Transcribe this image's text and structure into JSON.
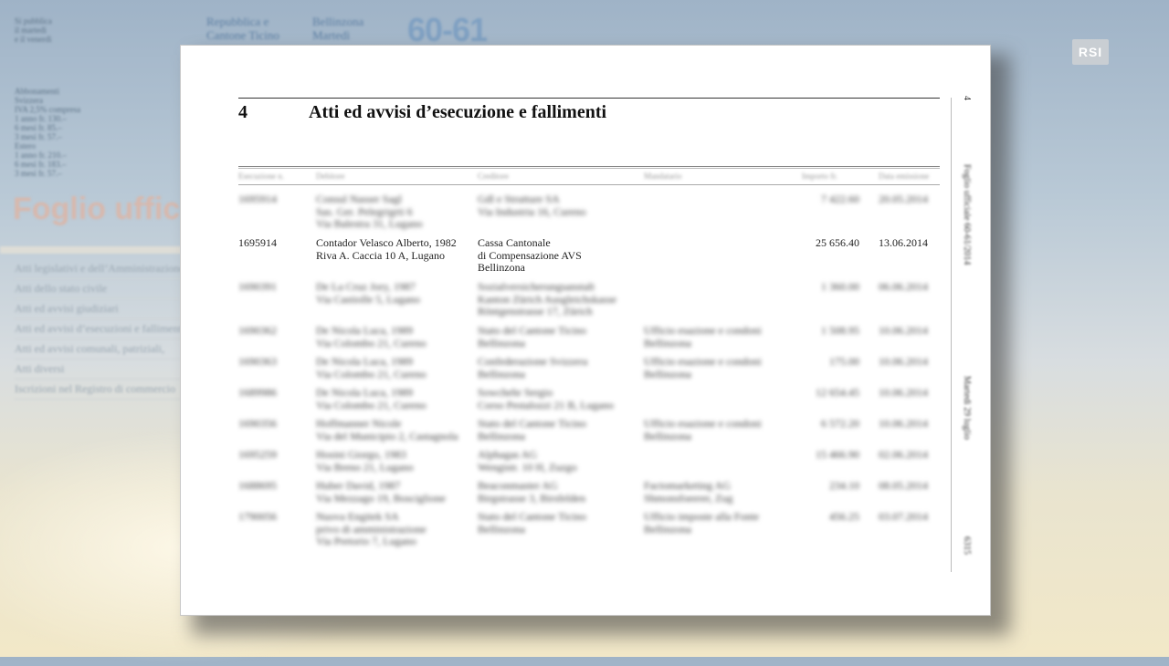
{
  "background": {
    "header_left": [
      "Si pubblica",
      "il martedì",
      "e il venerdì"
    ],
    "subscriptions": [
      "Abbonamenti",
      "Svizzera",
      "IVA 2,5% compresa",
      "1 anno fr. 130.–",
      "6 mesi fr. 85.–",
      "3 mesi fr. 57.–",
      "Estero",
      "1 anno fr. 210.–",
      "6 mesi fr. 183.–",
      "3 mesi fr. 57.–"
    ],
    "header_col1": [
      "Repubblica e",
      "Cantone Ticino"
    ],
    "header_col2": [
      "Bellinzona",
      "Martedì"
    ],
    "issue_number": "60-61",
    "masthead": "Foglio uffic",
    "menu": [
      "Atti legislativi e dell’Amministrazione",
      "Atti dello stato civile",
      "Atti ed avvisi giudiziari",
      "Atti ed avvisi d’esecuzioni e fallimenti",
      "Atti ed avvisi comunali, patriziali,",
      "Atti diversi",
      "Iscrizioni nel Registro di commercio"
    ]
  },
  "broadcaster_logo": "RSI",
  "document": {
    "section_number": "4",
    "section_title": "Atti ed avvisi d’esecuzione e fallimenti",
    "side_page_num": "4",
    "side_pub": "Foglio ufficiale 60-61/2014",
    "side_date": "Martedì 29 luglio",
    "side_page": "6315",
    "columns": [
      "Esecuzione n.",
      "Debitore",
      "Creditore",
      "Mandatario",
      "Importo fr.",
      "Data emissione"
    ],
    "rows": [
      {
        "num": "1695914",
        "debtor": [
          "Contador Velasco Alberto, 1982",
          "Riva A. Caccia 10 A, Lugano"
        ],
        "creditor": [
          "Cassa Cantonale",
          "di Compensazione AVS",
          "Bellinzona"
        ],
        "agent": [],
        "amount": "25 656.40",
        "date": "13.06.2014"
      }
    ],
    "blurred_rows": [
      {
        "num": "1695914",
        "debtor": [
          "Consul Nasser Sagl",
          "Sas. Ger. Pelegrigrti 6",
          "Via Balestra 31, Lugano"
        ],
        "creditor": [
          "Gdl e Strutture SA",
          "Via Industria 16, Cureno"
        ],
        "agent": [],
        "amount": "7 422.60",
        "date": "20.05.2014"
      },
      {
        "num": "1690391",
        "debtor": [
          "De La Cruz Jory, 1987",
          "Via Castiolle 5, Lugano"
        ],
        "creditor": [
          "Sozialversicherungsanstalt",
          "Kanton Zürich Ausgleichskasse",
          "Röntgenstrasse 17, Zürich"
        ],
        "agent": [],
        "amount": "1 360.00",
        "date": "06.06.2014"
      },
      {
        "num": "1690362",
        "debtor": [
          "De Nicola Luca, 1989",
          "Via Colombo 21, Cureno"
        ],
        "creditor": [
          "Stato del Cantone Ticino",
          "Bellinzona"
        ],
        "agent": [
          "Ufficio esazione e condoni",
          "Bellinzona"
        ],
        "amount": "1 508.95",
        "date": "10.06.2014"
      },
      {
        "num": "1690363",
        "debtor": [
          "De Nicola Luca, 1989",
          "Via Colombo 21, Cureno"
        ],
        "creditor": [
          "Confederazione Svizzera",
          "Bellinzona"
        ],
        "agent": [
          "Ufficio esazione e condoni",
          "Bellinzona"
        ],
        "amount": "175.00",
        "date": "10.06.2014"
      },
      {
        "num": "1689986",
        "debtor": [
          "De Nicola Luca, 1989",
          "Via Colombo 21, Cureno"
        ],
        "creditor": [
          "Sowchehr Sergio",
          "Corso Pestalozzi 21 B, Lugano"
        ],
        "agent": [],
        "amount": "12 654.45",
        "date": "10.06.2014"
      },
      {
        "num": "1690356",
        "debtor": [
          "Hoffmanner Nicole",
          "Via del Municipio 2, Castagnola"
        ],
        "creditor": [
          "Stato del Cantone Ticino",
          "Bellinzona"
        ],
        "agent": [
          "Ufficio esazione e condoni",
          "Bellinzona"
        ],
        "amount": "6 572.20",
        "date": "10.06.2014"
      },
      {
        "num": "1695259",
        "debtor": [
          "Hosini Giorgo, 1983",
          "Via Breno 21, Lugano"
        ],
        "creditor": [
          "Alphagas AG",
          "Wengistr. 10 H, Zuzgo"
        ],
        "agent": [],
        "amount": "15 466.90",
        "date": "02.06.2014"
      },
      {
        "num": "1688695",
        "debtor": [
          "Huber David, 1987",
          "Via Mezzago 19, Bosciglione"
        ],
        "creditor": [
          "Beaconmaster AG",
          "Birgstrasse 3, Birsfelden"
        ],
        "agent": [
          "Factomarketing AG",
          "Shmonsfoeerer, Zug"
        ],
        "amount": "234.10",
        "date": "08.05.2014"
      },
      {
        "num": "1790056",
        "debtor": [
          "Nuova Engitek SA",
          "privo di amministrazione",
          "Via Pretorio 7, Lugano"
        ],
        "creditor": [
          "Stato del Cantone Ticino",
          "Bellinzona"
        ],
        "agent": [
          "Ufficio imposte alla Fonte",
          "Bellinzona"
        ],
        "amount": "456.25",
        "date": "03.07.2014"
      }
    ]
  }
}
